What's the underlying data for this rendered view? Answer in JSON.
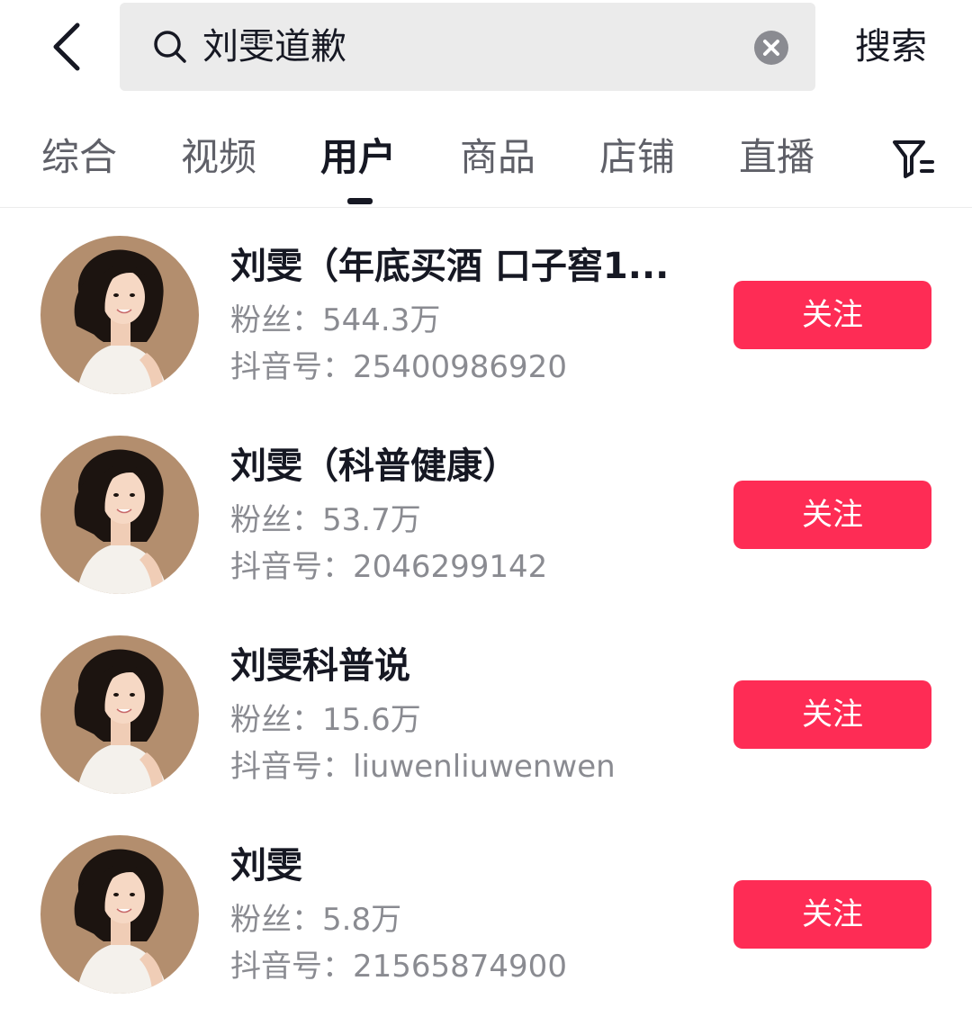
{
  "search": {
    "query": "刘雯道歉",
    "submit_label": "搜索"
  },
  "tabs": [
    {
      "label": "综合"
    },
    {
      "label": "视频"
    },
    {
      "label": "用户",
      "active": true
    },
    {
      "label": "商品"
    },
    {
      "label": "店铺"
    },
    {
      "label": "直播"
    }
  ],
  "icons": {
    "back": "chevron-left-icon",
    "search": "search-icon",
    "clear": "clear-icon",
    "filter": "filter-icon"
  },
  "colors": {
    "accent": "#fe2c55",
    "search_bg": "#ebebeb",
    "secondary_text": "#8a8b91"
  },
  "users": [
    {
      "name": "刘雯（年底买酒 口子窖1...",
      "fans_label": "粉丝：",
      "fans": "544.3万",
      "id_label": "抖音号：",
      "id": "25400986920",
      "follow_label": "关注"
    },
    {
      "name": "刘雯（科普健康）",
      "fans_label": "粉丝：",
      "fans": "53.7万",
      "id_label": "抖音号：",
      "id": "2046299142",
      "follow_label": "关注"
    },
    {
      "name": "刘雯科普说",
      "fans_label": "粉丝：",
      "fans": "15.6万",
      "id_label": "抖音号：",
      "id": "liuwenliuwenwen",
      "follow_label": "关注"
    },
    {
      "name": "刘雯",
      "fans_label": "粉丝：",
      "fans": "5.8万",
      "id_label": "抖音号：",
      "id": "21565874900",
      "follow_label": "关注"
    }
  ]
}
